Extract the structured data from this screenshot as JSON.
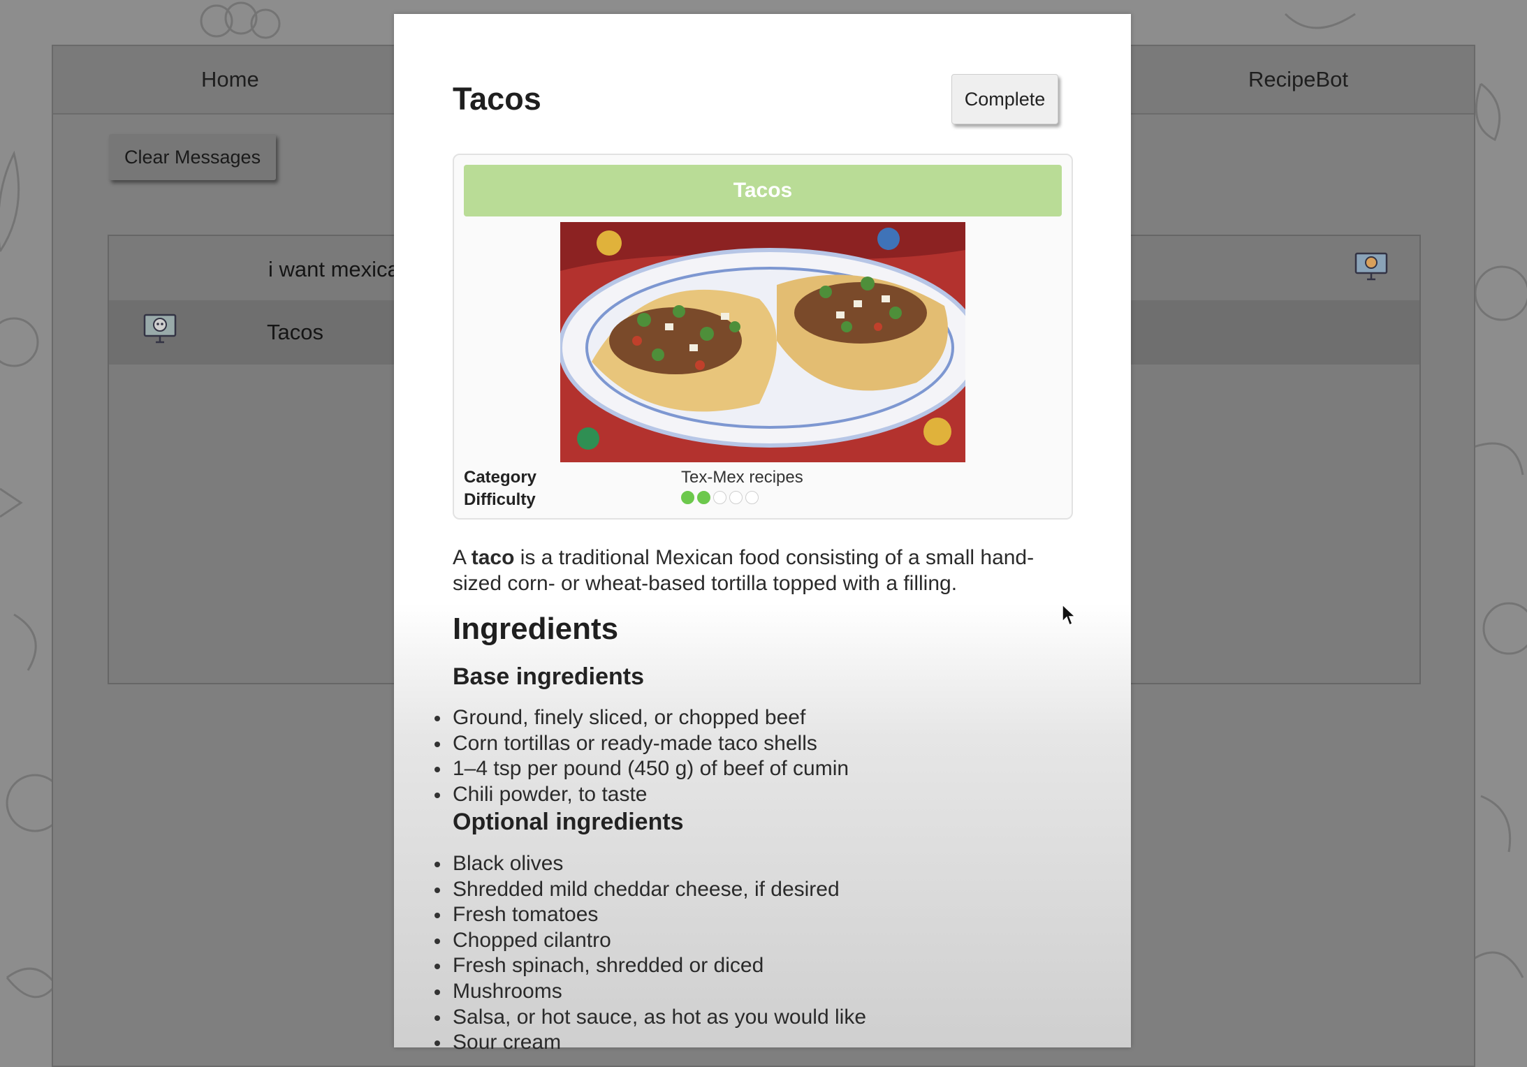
{
  "nav": {
    "home": "Home",
    "recipebot": "RecipeBot"
  },
  "toolbar": {
    "clear_label": "Clear Messages"
  },
  "chat": {
    "user_message": "i want mexican foo",
    "bot_message": "Tacos"
  },
  "modal": {
    "title": "Tacos",
    "complete_label": "Complete",
    "card": {
      "banner": "Tacos",
      "category_label": "Category",
      "category_value": "Tex-Mex recipes",
      "difficulty_label": "Difficulty",
      "difficulty_level": 2,
      "difficulty_max": 5
    },
    "intro": {
      "before": "A ",
      "bold": "taco",
      "after": " is a traditional Mexican food consisting of a small hand-sized corn- or wheat-based tortilla topped with a filling."
    },
    "ingredients_heading": "Ingredients",
    "base_heading": "Base ingredients",
    "base_items": [
      "Ground, finely sliced, or chopped beef",
      "Corn tortillas or ready-made taco shells",
      "1–4 tsp per pound (450 g) of beef of cumin",
      "Chili powder, to taste"
    ],
    "optional_heading": "Optional ingredients",
    "optional_items": [
      "Black olives",
      "Shredded mild cheddar cheese, if desired",
      "Fresh tomatoes",
      "Chopped cilantro",
      "Fresh spinach, shredded or diced",
      "Mushrooms",
      "Salsa, or hot sauce, as hot as you would like",
      "Sour cream"
    ]
  },
  "colors": {
    "banner": "#b9dc96",
    "difficulty_dot_on": "#6cc84c",
    "overlay": "#8d8d8d"
  },
  "icons": [
    "bot-avatar-icon",
    "user-avatar-icon",
    "mouse-cursor-icon"
  ]
}
